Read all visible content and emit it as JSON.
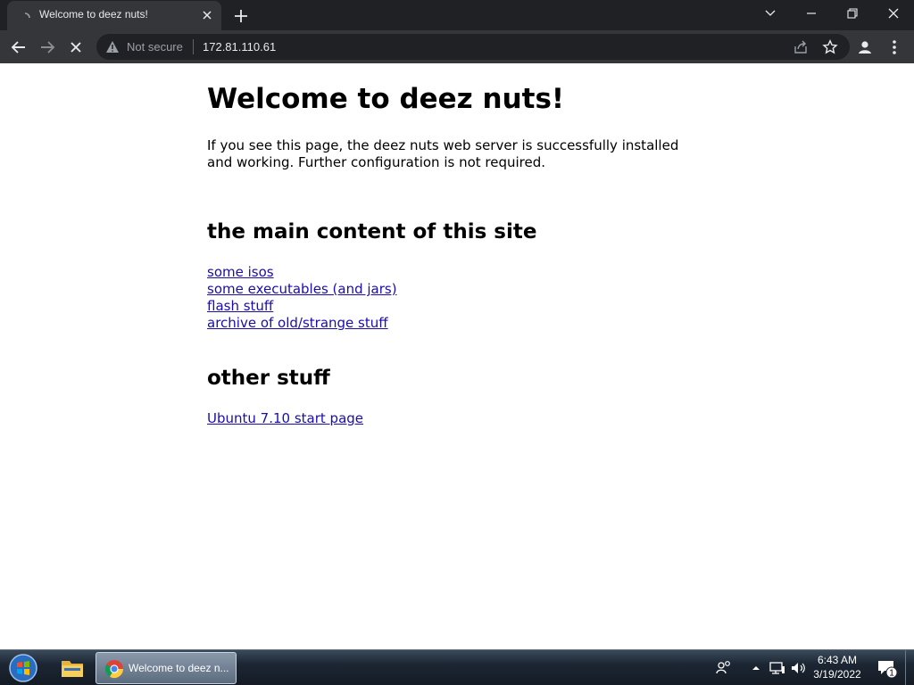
{
  "browser": {
    "tab_title": "Welcome to deez nuts!",
    "security_label": "Not secure",
    "url": "172.81.110.61"
  },
  "page": {
    "heading": "Welcome to deez nuts!",
    "intro": "If you see this page, the deez nuts web server is successfully installed and working. Further configuration is not required.",
    "section_main": {
      "title": "the main content of this site",
      "links": [
        "some isos",
        "some executables (and jars)",
        "flash stuff",
        "archive of old/strange stuff"
      ]
    },
    "section_other": {
      "title": "other stuff",
      "links": [
        "Ubuntu 7.10 start page"
      ]
    }
  },
  "taskbar": {
    "chrome_label": "Welcome to deez n...",
    "time": "6:43 AM",
    "date": "3/19/2022",
    "notification_count": "1"
  },
  "colors": {
    "link": "#1a0dab",
    "browser_frame": "#202124",
    "toolbar": "#35363a"
  },
  "icons": [
    "loading-spinner-icon",
    "close-icon",
    "plus-icon",
    "chevron-down-icon",
    "minimize-icon",
    "restore-icon",
    "back-arrow-icon",
    "forward-arrow-icon",
    "stop-icon",
    "warning-icon",
    "share-icon",
    "star-icon",
    "profile-icon",
    "more-vert-icon",
    "windows-logo-icon",
    "folder-icon",
    "chrome-icon",
    "people-icon",
    "up-arrow-icon",
    "network-icon",
    "volume-icon",
    "notification-icon"
  ]
}
